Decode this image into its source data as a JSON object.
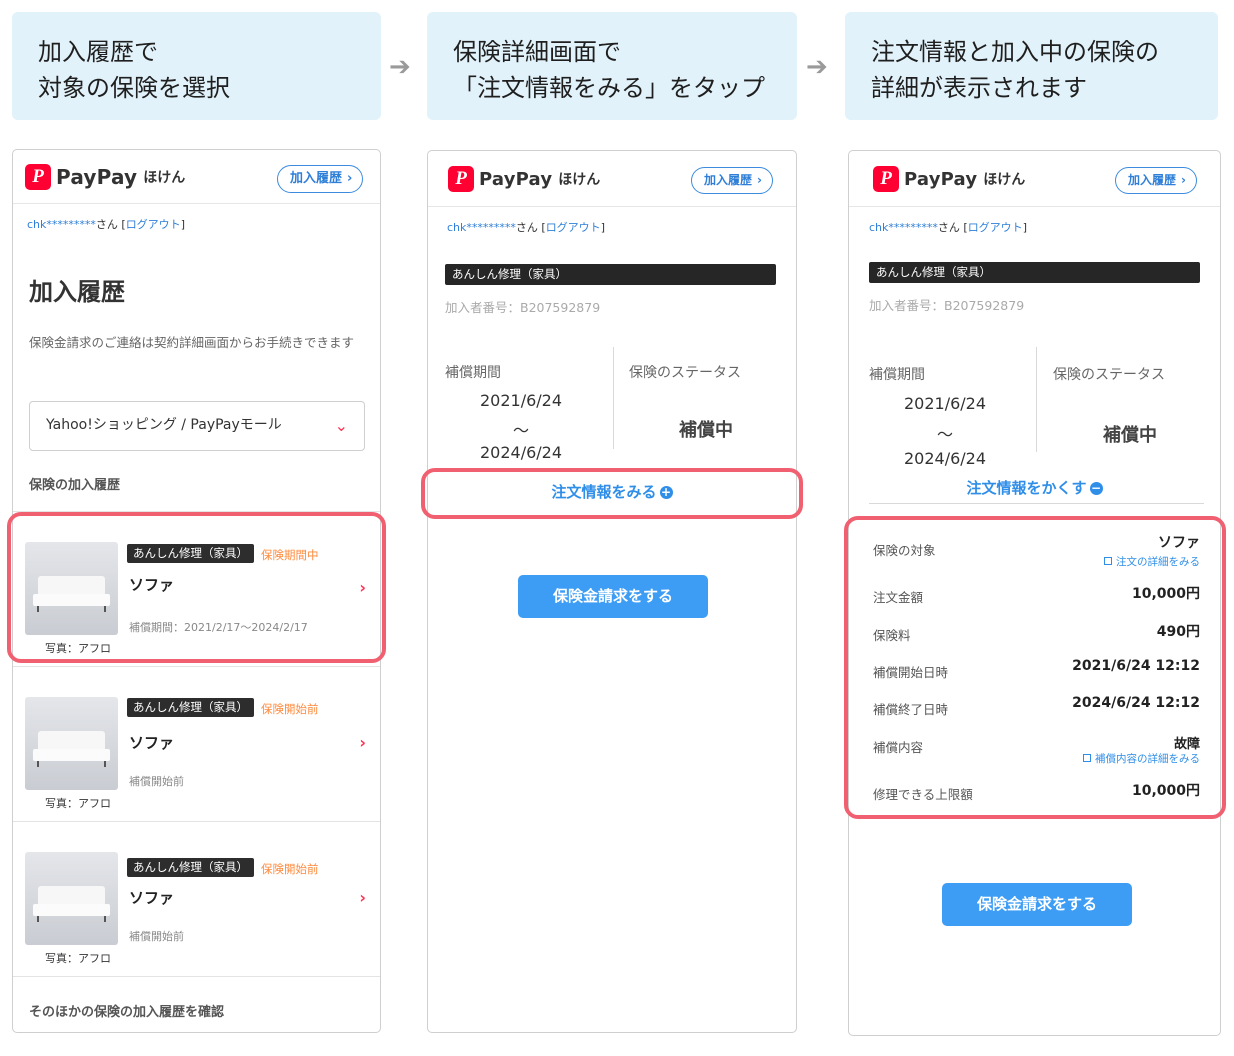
{
  "steps": [
    {
      "line1": "加入履歴で",
      "line2": "対象の保険を選択"
    },
    {
      "line1": "保険詳細画面で",
      "line2": "「注文情報をみる」をタップ"
    },
    {
      "line1": "注文情報と加入中の保険の",
      "line2": "詳細が表示されます"
    }
  ],
  "arrow": "➔",
  "header": {
    "logo_mark": "P",
    "logo_text": "PayPay",
    "logo_sub": "ほけん",
    "history_button": "加入履歴",
    "chevron": "›"
  },
  "user": {
    "name": "chk*********",
    "san": "さん",
    "bracket_open": "[",
    "logout": "ログアウト",
    "bracket_close": "]"
  },
  "screen1": {
    "title": "加入履歴",
    "note": "保険金請求のご連絡は契約詳細画面からお手続きできます",
    "store_select": "Yahoo!ショッピング / PayPayモール",
    "section_label": "保険の加入履歴",
    "items": [
      {
        "tag": "あんしん修理（家具）",
        "status": "保険期間中",
        "name": "ソファ",
        "period": "補償期間：2021/2/17〜2024/2/17",
        "photo_caption": "写真：アフロ"
      },
      {
        "tag": "あんしん修理（家具）",
        "status": "保険開始前",
        "name": "ソファ",
        "period": "補償開始前",
        "photo_caption": "写真：アフロ"
      },
      {
        "tag": "あんしん修理（家具）",
        "status": "保険開始前",
        "name": "ソファ",
        "period": "補償開始前",
        "photo_caption": "写真：アフロ"
      }
    ],
    "other_link": "そのほかの保険の加入履歴を確認"
  },
  "detail": {
    "product": "あんしん修理（家具）",
    "member_no": "加入者番号：B207592879",
    "period_label": "補償期間",
    "start": "2021/6/24",
    "tilde": "〜",
    "end": "2024/6/24",
    "status_label": "保険のステータス",
    "status_value": "補償中",
    "show_order": "注文情報をみる",
    "hide_order": "注文情報をかくす",
    "plus": "+",
    "minus": "−",
    "claim_button": "保険金請求をする"
  },
  "order": {
    "rows": [
      {
        "label": "保険の対象",
        "value": "ソファ",
        "sub": "注文の詳細をみる"
      },
      {
        "label": "注文金額",
        "value": "10,000円"
      },
      {
        "label": "保険料",
        "value": "490円"
      },
      {
        "label": "補償開始日時",
        "value": "2021/6/24 12:12"
      },
      {
        "label": "補償終了日時",
        "value": "2024/6/24 12:12"
      },
      {
        "label": "補償内容",
        "value": "故障",
        "sub": "補償内容の詳細をみる"
      },
      {
        "label": "修理できる上限額",
        "value": "10,000円"
      }
    ]
  },
  "colors": {
    "brand_red": "#ff0033",
    "link_blue": "#2f8ee8",
    "highlight": "#f06070",
    "step_bg": "#e2f2fa",
    "status_orange": "#ff8a3d"
  }
}
